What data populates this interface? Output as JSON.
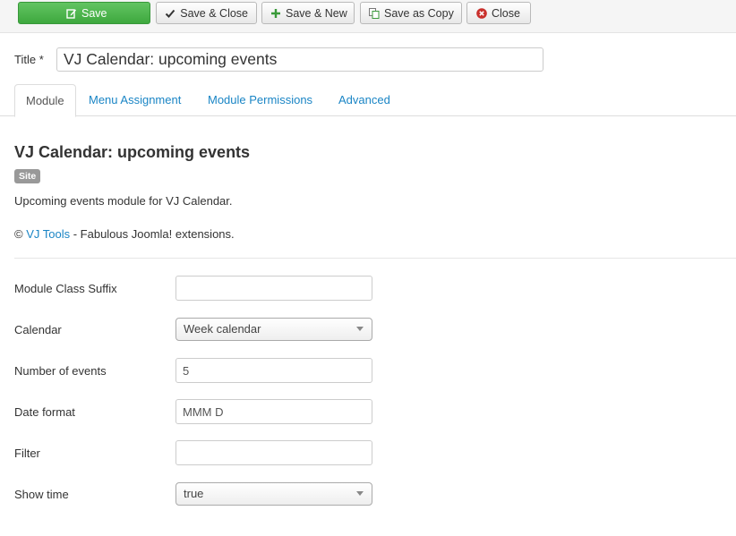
{
  "toolbar": {
    "save": "Save",
    "save_close": "Save & Close",
    "save_new": "Save & New",
    "save_copy": "Save as Copy",
    "close": "Close"
  },
  "title": {
    "label": "Title *",
    "value": "VJ Calendar: upcoming events"
  },
  "tabs": [
    "Module",
    "Menu Assignment",
    "Module Permissions",
    "Advanced"
  ],
  "module": {
    "heading": "VJ Calendar: upcoming events",
    "badge": "Site",
    "description": "Upcoming events module for VJ Calendar.",
    "credit_prefix": "© ",
    "credit_link": "VJ Tools",
    "credit_suffix": " - Fabulous Joomla! extensions."
  },
  "fields": {
    "class_suffix": {
      "label": "Module Class Suffix",
      "value": ""
    },
    "calendar": {
      "label": "Calendar",
      "value": "Week calendar"
    },
    "num_events": {
      "label": "Number of events",
      "value": "5"
    },
    "date_format": {
      "label": "Date format",
      "value": "MMM D"
    },
    "filter": {
      "label": "Filter",
      "value": ""
    },
    "show_time": {
      "label": "Show time",
      "value": "true"
    }
  },
  "colors": {
    "save_green": "#4cae4c",
    "link_blue": "#1a85c5",
    "close_red": "#c9302c"
  }
}
